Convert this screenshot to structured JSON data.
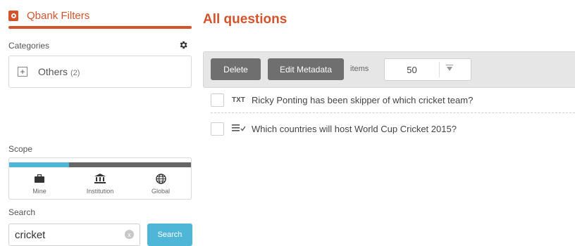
{
  "sidebar": {
    "title": "Qbank Filters",
    "categories": {
      "label": "Categories",
      "items": [
        {
          "name": "Others",
          "count": "(2)"
        }
      ]
    },
    "scope": {
      "label": "Scope",
      "selected_fraction": 0.33,
      "options": [
        {
          "label": "Mine",
          "icon": "briefcase-icon"
        },
        {
          "label": "Institution",
          "icon": "institution-icon"
        },
        {
          "label": "Global",
          "icon": "globe-icon"
        }
      ]
    },
    "search": {
      "label": "Search",
      "value": "cricket",
      "clear_glyph": "x",
      "button": "Search"
    }
  },
  "main": {
    "title": "All questions",
    "toolbar": {
      "delete": "Delete",
      "edit_metadata": "Edit Metadata",
      "items_label": "items",
      "items_value": "50"
    },
    "questions": [
      {
        "type": "TXT",
        "text": "Ricky Ponting has been skipper of which cricket team?"
      },
      {
        "type": "",
        "type_icon": "list-check-icon",
        "text": "Which countries will host World Cup Cricket 2015?"
      }
    ]
  },
  "colors": {
    "accent": "#d4532b",
    "primary": "#4fb6d8",
    "button_dark": "#6f6f6f"
  }
}
